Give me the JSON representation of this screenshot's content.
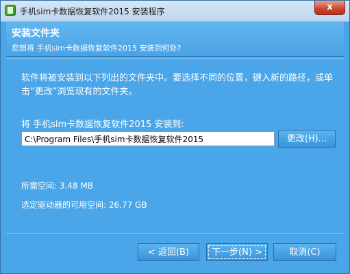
{
  "window": {
    "title": "手机sim卡数据恢复软件2015 安装程序",
    "close_glyph": "x"
  },
  "header": {
    "title": "安装文件夹",
    "subtitle": "您想将 手机sim卡数据恢复软件2015 安装到何处?"
  },
  "body": {
    "instructions": "软件将被安装到以下列出的文件夹中。要选择不同的位置，键入新的路径，或单击“更改”浏览现有的文件夹。",
    "install_label": "将 手机sim卡数据恢复软件2015 安装到:",
    "path_value": "C:\\Program Files\\手机sim卡数据恢复软件2015",
    "browse_label": "更改(H)...",
    "required_space": "所需空间: 3.48 MB",
    "available_space": "选定驱动器的可用空间: 26.77 GB"
  },
  "footer": {
    "back_label": "< 返回(B)",
    "next_label": "下一步(N) >",
    "cancel_label": "取消(C)"
  },
  "colors": {
    "background": "#4aa6e8",
    "close_button": "#c9452c"
  },
  "icons": {
    "app": "installer-app-icon",
    "close": "close-icon"
  }
}
